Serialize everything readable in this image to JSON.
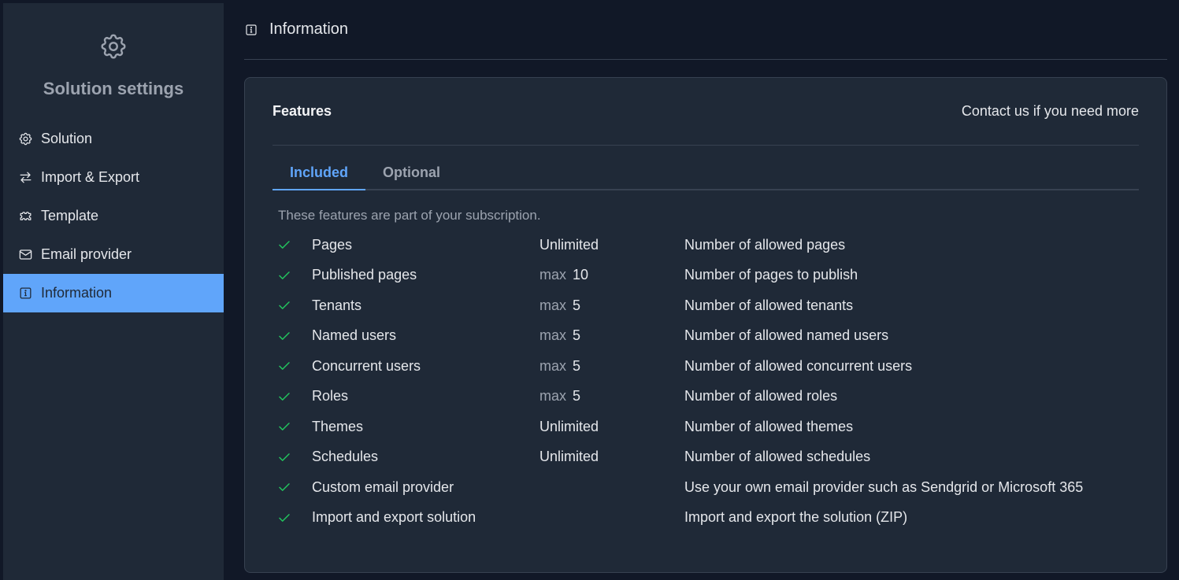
{
  "sidebar": {
    "title": "Solution settings",
    "header_icon": "gear-icon",
    "items": [
      {
        "label": "Solution",
        "icon": "gear-icon"
      },
      {
        "label": "Import & Export",
        "icon": "arrows-icon"
      },
      {
        "label": "Template",
        "icon": "puzzle-icon"
      },
      {
        "label": "Email provider",
        "icon": "mail-icon"
      },
      {
        "label": "Information",
        "icon": "info-icon",
        "active": true
      }
    ]
  },
  "header": {
    "title": "Information",
    "icon": "info-icon"
  },
  "card": {
    "title": "Features",
    "contact": "Contact us if you need more",
    "tabs": [
      {
        "label": "Included",
        "active": true
      },
      {
        "label": "Optional",
        "active": false
      }
    ],
    "intro": "These features are part of your subscription.",
    "features": [
      {
        "name": "Pages",
        "prefix": "",
        "limit": "Unlimited",
        "description": "Number of allowed pages"
      },
      {
        "name": "Published pages",
        "prefix": "max",
        "limit": "10",
        "description": "Number of pages to publish"
      },
      {
        "name": "Tenants",
        "prefix": "max",
        "limit": "5",
        "description": "Number of allowed tenants"
      },
      {
        "name": "Named users",
        "prefix": "max",
        "limit": "5",
        "description": "Number of allowed named users"
      },
      {
        "name": "Concurrent users",
        "prefix": "max",
        "limit": "5",
        "description": "Number of allowed concurrent users"
      },
      {
        "name": "Roles",
        "prefix": "max",
        "limit": "5",
        "description": "Number of allowed roles"
      },
      {
        "name": "Themes",
        "prefix": "",
        "limit": "Unlimited",
        "description": "Number of allowed themes"
      },
      {
        "name": "Schedules",
        "prefix": "",
        "limit": "Unlimited",
        "description": "Number of allowed schedules"
      },
      {
        "name": "Custom email provider",
        "prefix": "",
        "limit": "",
        "description": "Use your own email provider such as Sendgrid or Microsoft 365"
      },
      {
        "name": "Import and export solution",
        "prefix": "",
        "limit": "",
        "description": "Import and export the solution (ZIP)"
      }
    ]
  },
  "colors": {
    "accent": "#60a5fa",
    "check": "#22c55e",
    "background": "#111827",
    "panel": "#1f2937"
  }
}
